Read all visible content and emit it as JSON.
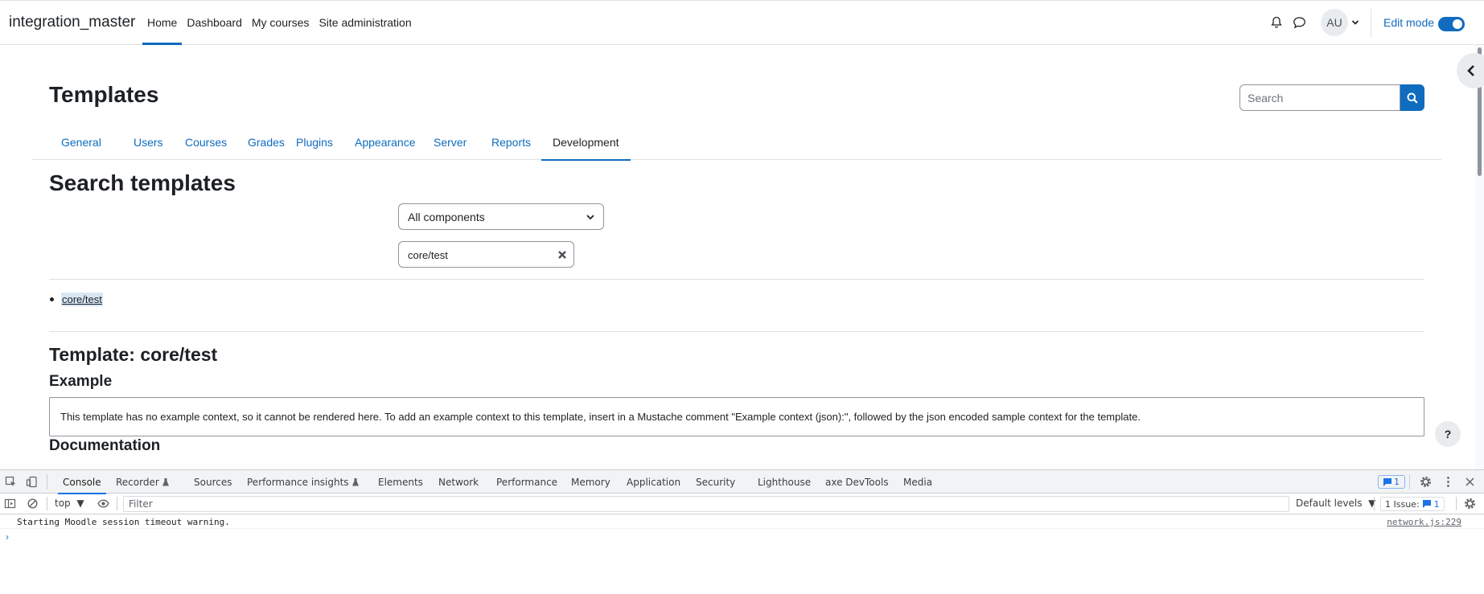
{
  "navbar": {
    "brand": "integration_master",
    "items": [
      "Home",
      "Dashboard",
      "My courses",
      "Site administration"
    ],
    "user_initials": "AU",
    "edit_mode_label": "Edit mode"
  },
  "page": {
    "title": "Templates",
    "search_placeholder": "Search"
  },
  "tabs": [
    "General",
    "Users",
    "Courses",
    "Grades",
    "Plugins",
    "Appearance",
    "Server",
    "Reports",
    "Development"
  ],
  "active_tab": "Development",
  "search_templates": {
    "title": "Search templates",
    "component_select": "All components",
    "filter_value": "core/test",
    "results": [
      "core/test"
    ]
  },
  "template": {
    "title": "Template: core/test",
    "example_heading": "Example",
    "example_text": "This template has no example context, so it cannot be rendered here. To add an example context to this template, insert in a Mustache comment \"Example context (json):\", followed by the json encoded sample context for the template.",
    "documentation_heading": "Documentation",
    "help_label": "?"
  },
  "devtools": {
    "tabs": [
      "Console",
      "Recorder",
      "Sources",
      "Performance insights",
      "Elements",
      "Network",
      "Performance",
      "Memory",
      "Application",
      "Security",
      "Lighthouse",
      "axe DevTools",
      "Media"
    ],
    "active_tab": "Console",
    "message_count": "1",
    "context": "top",
    "filter_placeholder": "Filter",
    "levels": "Default levels",
    "issues_label": "1 Issue:",
    "issues_count": "1",
    "console": {
      "message": "Starting Moodle session timeout warning.",
      "source": "network.js:229"
    }
  },
  "colors": {
    "primary": "#0f6cbf",
    "devtools_accent": "#1a73e8"
  }
}
